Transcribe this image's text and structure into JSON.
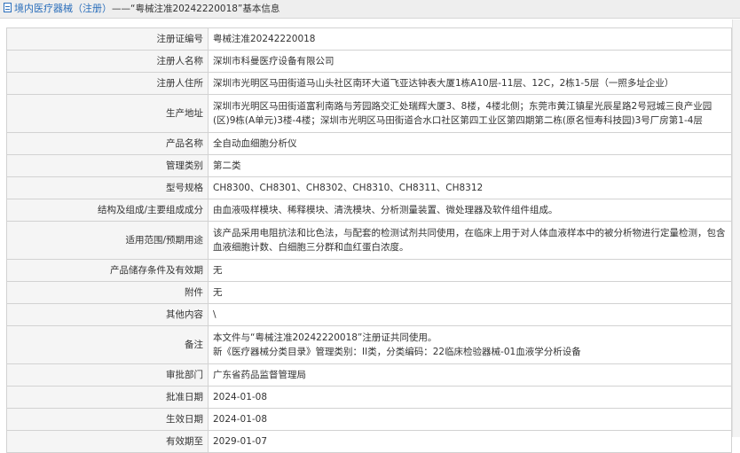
{
  "header": {
    "category_link": "境内医疗器械（注册）",
    "separator": "——",
    "title_suffix": "“粤械注准20242220018”基本信息"
  },
  "rows": [
    {
      "label": "注册证编号",
      "value": "粤械注准20242220018"
    },
    {
      "label": "注册人名称",
      "value": "深圳市科曼医疗设备有限公司"
    },
    {
      "label": "注册人住所",
      "value": "深圳市光明区马田街道马山头社区南环大道飞亚达钟表大厦1栋A10层-11层、12C，2栋1-5层（一照多址企业）"
    },
    {
      "label": "生产地址",
      "value": "深圳市光明区马田街道富利南路与芳园路交汇处瑞辉大厦3、8楼，4楼北侧；东莞市黄江镇星光辰星路2号冠城三良产业园(区)9栋(A单元)3楼-4楼；深圳市光明区马田街道合水口社区第四工业区第四期第二栋(原名恒寿科技园)3号厂房第1-4层"
    },
    {
      "label": "产品名称",
      "value": "全自动血细胞分析仪"
    },
    {
      "label": "管理类别",
      "value": "第二类"
    },
    {
      "label": "型号规格",
      "value": "CH8300、CH8301、CH8302、CH8310、CH8311、CH8312"
    },
    {
      "label": "结构及组成/主要组成成分",
      "value": "由血液吸样模块、稀释模块、清洗模块、分析测量装置、微处理器及软件组件组成。"
    },
    {
      "label": "适用范围/预期用途",
      "value": "该产品采用电阻抗法和比色法，与配套的检测试剂共同使用，在临床上用于对人体血液样本中的被分析物进行定量检测，包含血液细胞计数、白细胞三分群和血红蛋白浓度。"
    },
    {
      "label": "产品储存条件及有效期",
      "value": "无"
    },
    {
      "label": "附件",
      "value": "无"
    },
    {
      "label": "其他内容",
      "value": "\\"
    },
    {
      "label": "备注",
      "value_lines": [
        "本文件与“粤械注准20242220018”注册证共同使用。",
        "新《医疗器械分类目录》管理类别：II类，分类编码：22临床检验器械-01血液学分析设备"
      ]
    },
    {
      "label": "审批部门",
      "value": "广东省药品监督管理局"
    },
    {
      "label": "批准日期",
      "value": "2024-01-08"
    },
    {
      "label": "生效日期",
      "value": "2024-01-08"
    },
    {
      "label": "有效期至",
      "value": "2029-01-07"
    }
  ]
}
